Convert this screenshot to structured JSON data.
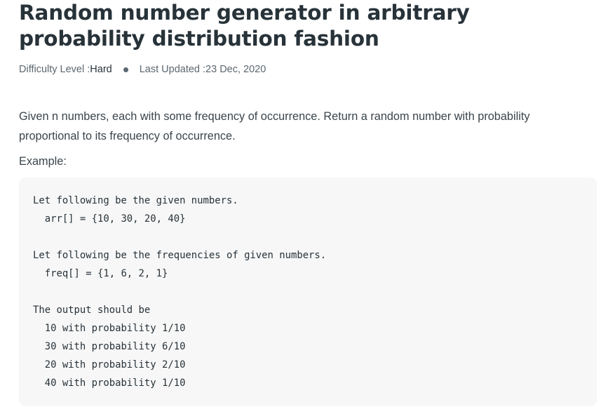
{
  "article": {
    "title": "Random number generator in arbitrary probability distribution fashion",
    "meta": {
      "difficulty_label": "Difficulty Level : ",
      "difficulty_value": "Hard",
      "updated_label": "Last Updated : ",
      "updated_value": "23 Dec, 2020"
    },
    "description": "Given n numbers, each with some frequency of occurrence. Return a random number with probability proportional to its frequency of occurrence.",
    "example_label": "Example:",
    "code_lines": [
      "Let following be the given numbers.",
      "  arr[] = {10, 30, 20, 40}",
      "",
      "Let following be the frequencies of given numbers.",
      "  freq[] = {1, 6, 2, 1}",
      "",
      "The output should be",
      "  10 with probability 1/10",
      "  30 with probability 6/10",
      "  20 with probability 2/10",
      "  40 with probability 1/10"
    ]
  }
}
